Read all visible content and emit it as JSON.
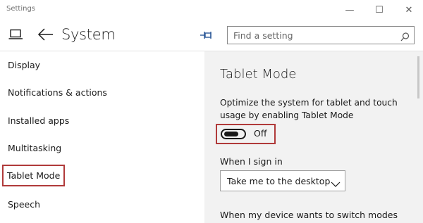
{
  "window": {
    "title": "Settings",
    "minimize": "—",
    "maximize": "☐",
    "close": "✕"
  },
  "header": {
    "title": "System",
    "search_placeholder": "Find a setting"
  },
  "sidebar": {
    "items": [
      {
        "label": "Display"
      },
      {
        "label": "Notifications & actions"
      },
      {
        "label": "Installed apps"
      },
      {
        "label": "Multitasking"
      },
      {
        "label": "Tablet Mode"
      },
      {
        "label": "Speech"
      }
    ],
    "selected_index": 4
  },
  "content": {
    "title": "Tablet Mode",
    "description": "Optimize the system for tablet and touch usage by enabling Tablet Mode",
    "toggle_state": "Off",
    "signin_label": "When I sign in",
    "signin_value": "Take me to the desktop",
    "switch_label": "When my device wants to switch modes"
  },
  "icons": [
    "laptop-icon",
    "back-arrow-icon",
    "pin-icon",
    "search-icon",
    "chevron-down-icon"
  ],
  "colors": {
    "highlight": "#b03a3a",
    "content_bg": "#f2f2f2"
  }
}
